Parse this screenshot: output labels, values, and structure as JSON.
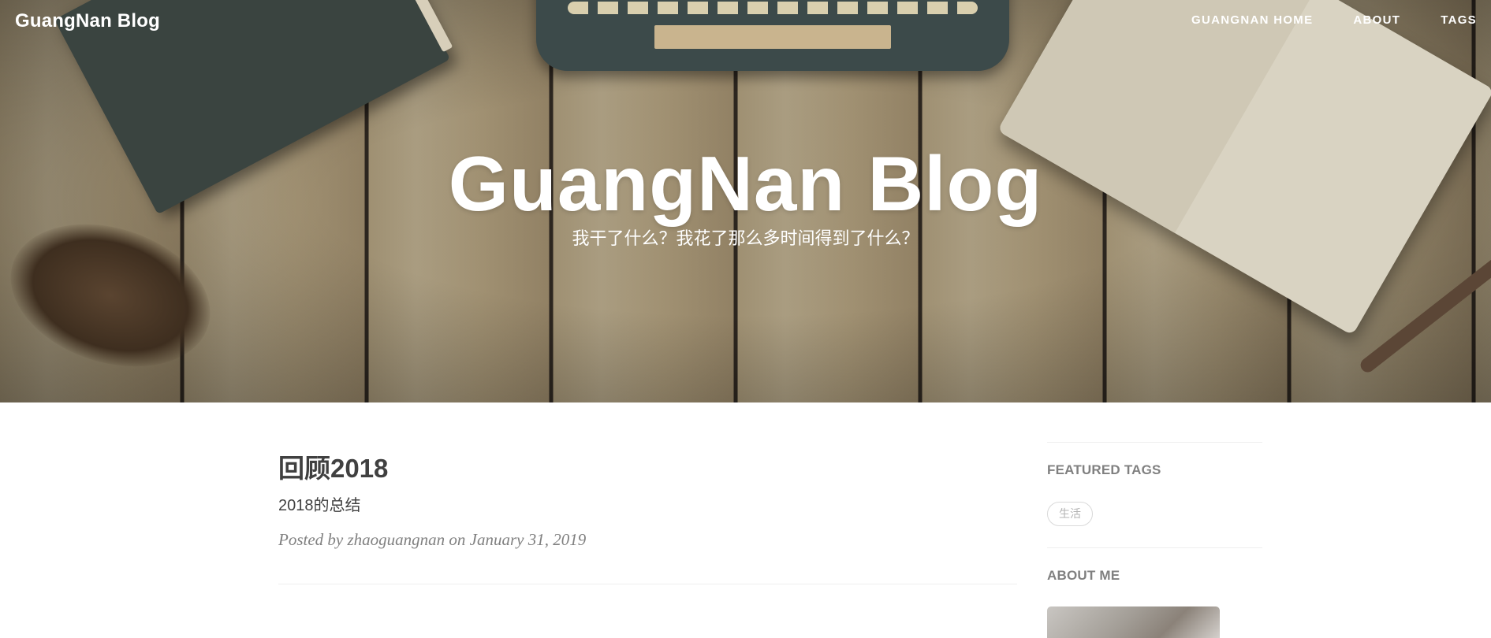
{
  "navbar": {
    "brand": "GuangNan Blog",
    "links": [
      "GUANGNAN HOME",
      "ABOUT",
      "TAGS"
    ]
  },
  "hero": {
    "title": "GuangNan Blog",
    "subtitle": "我干了什么？我花了那么多时间得到了什么？"
  },
  "posts": [
    {
      "title": "回顾2018",
      "subtitle": "2018的总结",
      "meta": "Posted by zhaoguangnan on January 31, 2019"
    }
  ],
  "sidebar": {
    "featured_tags_heading": "FEATURED TAGS",
    "tags": [
      "生活"
    ],
    "about_heading": "ABOUT ME"
  },
  "colors": {
    "text": "#404040",
    "meta": "#808080",
    "divider": "#eeeeee",
    "hero_text": "#ffffff"
  }
}
